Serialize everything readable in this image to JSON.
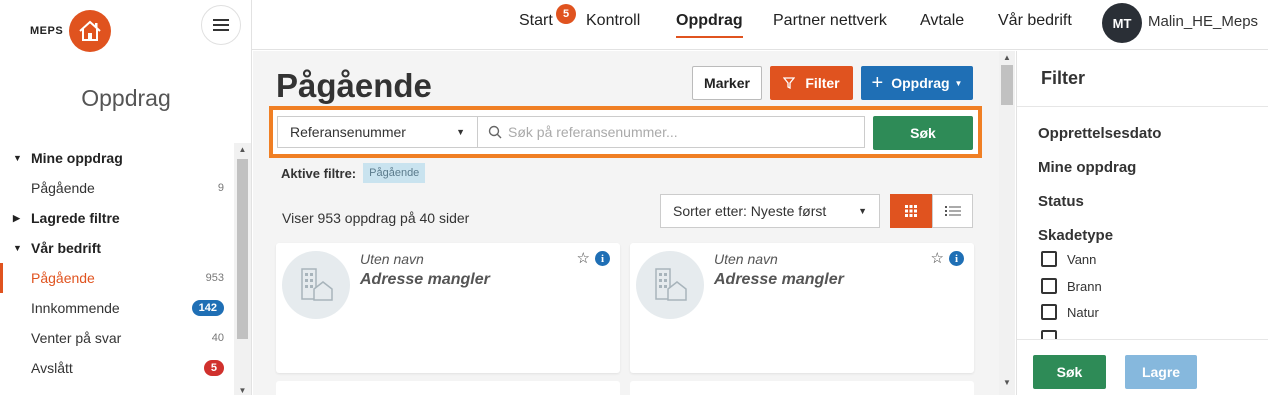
{
  "brand": {
    "logo_text": "MEPS",
    "accent": "#e0531f",
    "primary_blue": "#1f6fb5",
    "success_green": "#2e8b57"
  },
  "sidebar": {
    "title": "Oppdrag",
    "groups": [
      {
        "label": "Mine oppdrag",
        "expanded": true
      },
      {
        "label": "Lagrede filtre",
        "expanded": false
      },
      {
        "label": "Vår bedrift",
        "expanded": true
      }
    ],
    "items": [
      {
        "label": "Pågående",
        "count": "9"
      },
      {
        "label": "Pågående",
        "count": "953"
      },
      {
        "label": "Innkommende",
        "count": "142"
      },
      {
        "label": "Venter på svar",
        "count": "40"
      },
      {
        "label": "Avslått",
        "count": "5"
      }
    ]
  },
  "topnav": {
    "items": [
      "Start",
      "Kontroll",
      "Oppdrag",
      "Partner nettverk",
      "Avtale",
      "Vår bedrift"
    ],
    "start_badge": "5",
    "active": "Oppdrag",
    "user_initials": "MT",
    "username": "Malin_HE_Meps"
  },
  "main": {
    "title": "Pågående",
    "buttons": {
      "marker": "Marker",
      "filter": "Filter",
      "oppdrag": "Oppdrag"
    },
    "search": {
      "type_value": "Referansenummer",
      "placeholder": "Søk på referansenummer...",
      "button": "Søk"
    },
    "active_filters_label": "Aktive filtre:",
    "active_filter_tag": "Pågående",
    "result_text": "Viser 953 oppdrag på 40 sider",
    "sort_value": "Sorter etter: Nyeste først",
    "cards": [
      {
        "name": "Uten navn",
        "address": "Adresse mangler"
      },
      {
        "name": "Uten navn",
        "address": "Adresse mangler"
      }
    ]
  },
  "filter_panel": {
    "title": "Filter",
    "sections": [
      "Opprettelsesdato",
      "Mine oppdrag",
      "Status",
      "Skadetype"
    ],
    "skadetype_options": [
      "Vann",
      "Brann",
      "Natur"
    ],
    "buttons": {
      "search": "Søk",
      "save": "Lagre"
    }
  }
}
